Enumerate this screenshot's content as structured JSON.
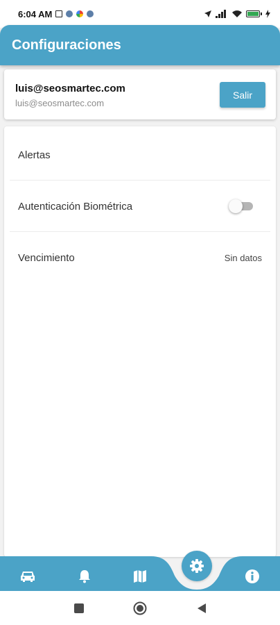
{
  "status_bar": {
    "time": "6:04 AM",
    "battery": "100",
    "battery_level": 1.0
  },
  "app_bar": {
    "title": "Configuraciones"
  },
  "account": {
    "name": "luis@seosmartec.com",
    "email": "luis@seosmartec.com",
    "logout_label": "Salir"
  },
  "settings": {
    "alerts_label": "Alertas",
    "biometric_label": "Autenticación Biométrica",
    "biometric_enabled": false,
    "expiry_label": "Vencimiento",
    "expiry_value": "Sin datos"
  },
  "bottom_nav": {
    "items": [
      {
        "icon": "car-icon"
      },
      {
        "icon": "bell-icon"
      },
      {
        "icon": "map-icon"
      },
      {
        "icon": "gear-icon",
        "active": true
      },
      {
        "icon": "info-icon"
      }
    ]
  },
  "colors": {
    "primary": "#4ba3c7",
    "surface": "#ffffff",
    "background": "#f2f2f2"
  }
}
